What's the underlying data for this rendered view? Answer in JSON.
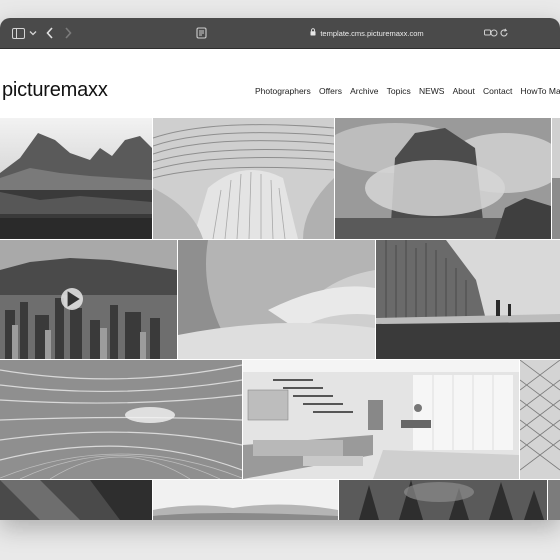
{
  "browser": {
    "url": "template.cms.picturemaxx.com",
    "icons": [
      "sidebar-icon",
      "chevron-down-icon",
      "back-arrow-icon",
      "forward-arrow-icon",
      "reader-icon",
      "lock-icon",
      "share-icon",
      "reload-icon"
    ]
  },
  "site": {
    "logo": "picturemaxx",
    "nav": [
      "Photographers",
      "Offers",
      "Archive",
      "Topics",
      "NEWS",
      "About",
      "Contact",
      "HowTo Manual"
    ]
  },
  "gallery": {
    "tiles": [
      {
        "name": "mountain-lake-photo"
      },
      {
        "name": "striped-architecture-photo"
      },
      {
        "name": "cloudy-rock-photo"
      },
      {
        "name": "city-video-thumbnail",
        "has_play_icon": true
      },
      {
        "name": "curved-concrete-wall-photo"
      },
      {
        "name": "basalt-columns-beach-photo"
      },
      {
        "name": "tunnel-motion-photo"
      },
      {
        "name": "modern-living-room-photo"
      },
      {
        "name": "geometric-facade-photo"
      },
      {
        "name": "dark-abstract-photo"
      },
      {
        "name": "misty-hills-photo"
      },
      {
        "name": "forest-trees-photo"
      }
    ]
  }
}
